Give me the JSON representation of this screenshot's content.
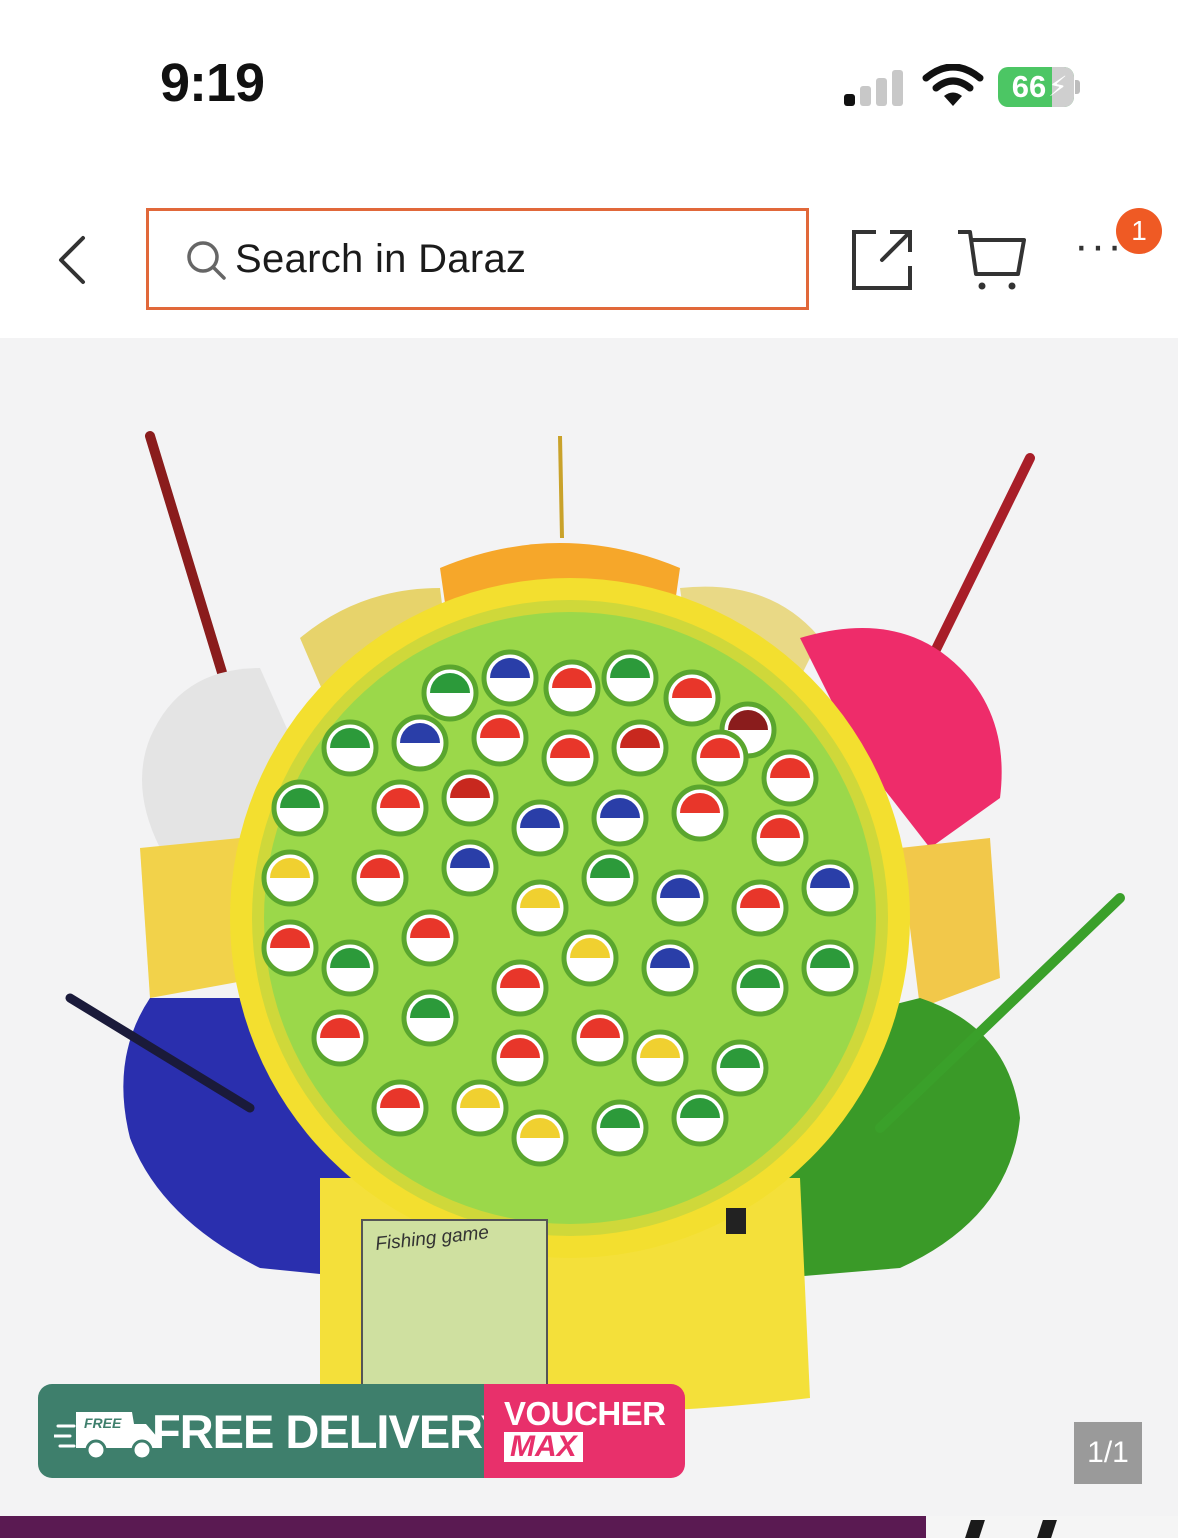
{
  "status_bar": {
    "time": "9:19",
    "battery_level": "66",
    "icons": [
      "signal-icon",
      "wifi-icon",
      "battery-icon"
    ]
  },
  "nav": {
    "search_placeholder": "Search in Daraz",
    "cart_badge_count": "1",
    "icons": [
      "back-icon",
      "search-icon",
      "share-icon",
      "cart-icon",
      "more-icon"
    ],
    "accent_color": "#e1683a",
    "badge_color": "#ef5a24"
  },
  "product": {
    "image_alt": "Fishing game toy",
    "board_label": "Fishing game",
    "promo": {
      "free_label": "FREE",
      "delivery_label": "FREE DELIVERY",
      "voucher_label": "VOUCHER",
      "max_label": "MAX",
      "left_color": "#3e7f6c",
      "right_color": "#e8306b"
    },
    "page_indicator": "1/1"
  }
}
